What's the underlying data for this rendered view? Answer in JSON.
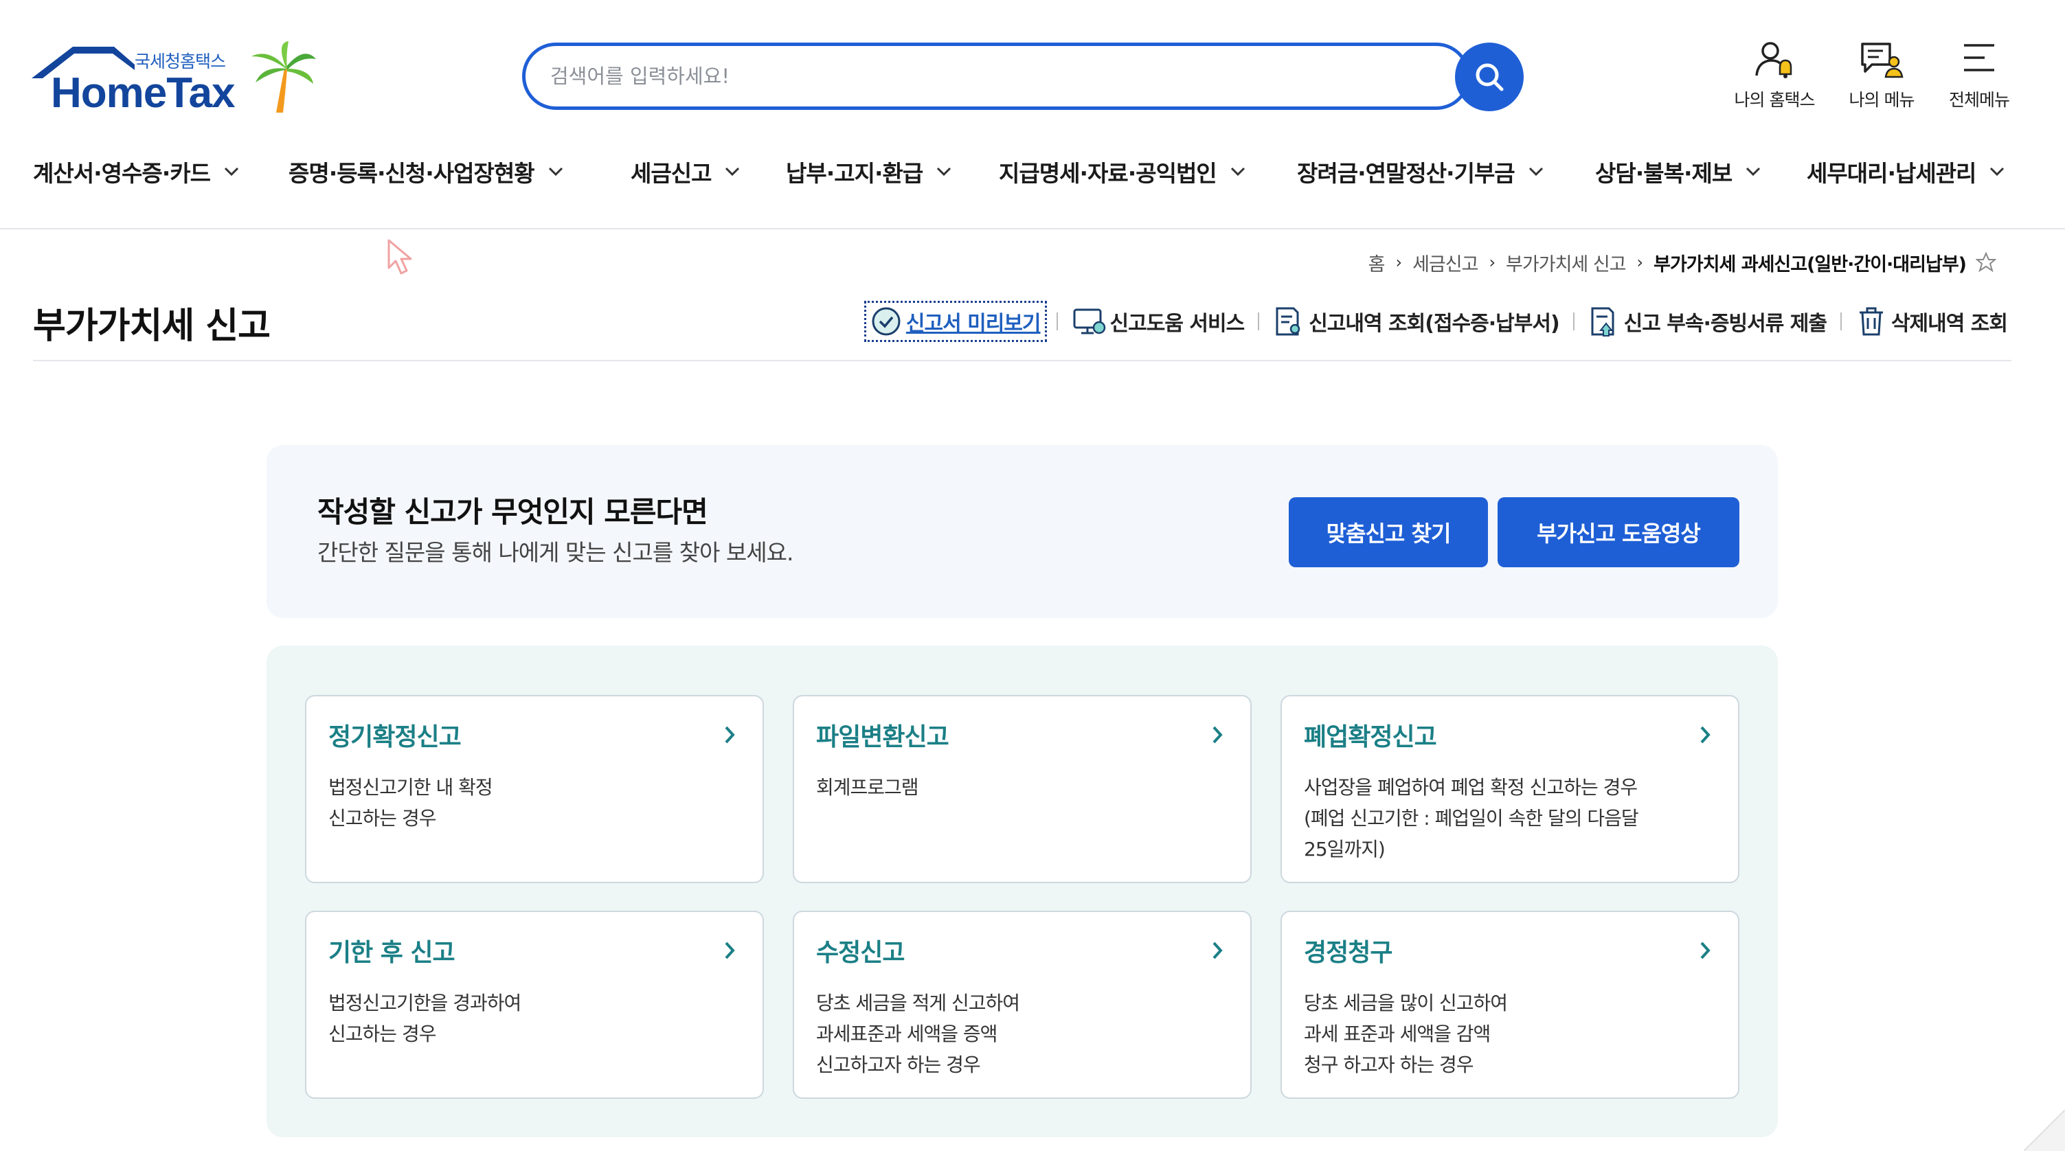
{
  "header": {
    "logo_sub": "국세청홈택스",
    "logo_main": "HomeTax",
    "search_placeholder": "검색어를 입력하세요!",
    "utils": [
      {
        "label": "나의 홈택스",
        "icon": "person-bell-icon"
      },
      {
        "label": "나의 메뉴",
        "icon": "chat-user-icon"
      },
      {
        "label": "전체메뉴",
        "icon": "hamburger-menu-icon"
      }
    ],
    "nav": [
      "계산서·영수증·카드",
      "증명·등록·신청·사업장현황",
      "세금신고",
      "납부·고지·환급",
      "지급명세·자료·공익법인",
      "장려금·연말정산·기부금",
      "상담·불복·제보",
      "세무대리·납세관리"
    ]
  },
  "breadcrumb": [
    "홈",
    "세금신고",
    "부가가치세 신고",
    "부가가치세 과세신고(일반·간이·대리납부)"
  ],
  "page_title": "부가가치세 신고",
  "quick_links": [
    {
      "label": "신고서 미리보기",
      "icon": "check-circle-icon"
    },
    {
      "label": "신고도움 서비스",
      "icon": "monitor-help-icon"
    },
    {
      "label": "신고내역 조회(접수증·납부서)",
      "icon": "document-search-icon"
    },
    {
      "label": "신고 부속·증빙서류 제출",
      "icon": "document-upload-icon"
    },
    {
      "label": "삭제내역 조회",
      "icon": "trash-icon"
    }
  ],
  "banner": {
    "title": "작성할 신고가 무엇인지 모른다면",
    "desc": "간단한 질문을 통해 나에게 맞는 신고를 찾아 보세요.",
    "btn1": "맞춤신고 찾기",
    "btn2": "부가신고 도움영상"
  },
  "cards": [
    {
      "title": "정기확정신고",
      "lines": [
        "법정신고기한 내 확정",
        "신고하는 경우"
      ]
    },
    {
      "title": "파일변환신고",
      "lines": [
        "회계프로그램"
      ]
    },
    {
      "title": "폐업확정신고",
      "lines": [
        "사업장을 폐업하여 폐업 확정 신고하는 경우",
        "(폐업 신고기한 : 폐업일이 속한 달의 다음달",
        "25일까지)"
      ]
    },
    {
      "title": "기한 후 신고",
      "lines": [
        "법정신고기한을 경과하여",
        "신고하는 경우"
      ]
    },
    {
      "title": "수정신고",
      "lines": [
        "당초 세금을 적게 신고하여",
        "과세표준과 세액을 증액",
        "신고하고자 하는 경우"
      ]
    },
    {
      "title": "경정청구",
      "lines": [
        "당초 세금을 많이 신고하여",
        "과세 표준과 세액을 감액",
        "청구 하고자 하는 경우"
      ]
    }
  ],
  "colors": {
    "primary_blue": "#1f5fd6",
    "card_title_teal": "#1b7f86",
    "banner_bg": "#f4f7fb",
    "cards_bg": "#eef6f6"
  }
}
